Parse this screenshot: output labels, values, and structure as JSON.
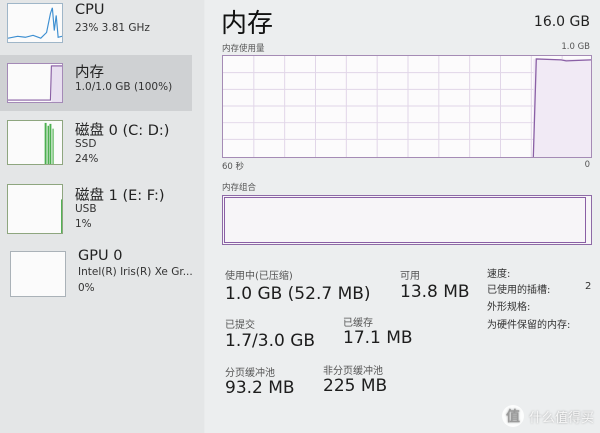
{
  "sidebar": {
    "items": [
      {
        "name": "CPU",
        "line1": "23%  3.81 GHz",
        "line2": ""
      },
      {
        "name": "内存",
        "line1": "1.0/1.0 GB (100%)",
        "line2": ""
      },
      {
        "name": "磁盘 0 (C: D:)",
        "line1": "SSD",
        "line2": "24%"
      },
      {
        "name": "磁盘 1 (E: F:)",
        "line1": "USB",
        "line2": "1%"
      },
      {
        "name": "GPU 0",
        "line1": "Intel(R) Iris(R) Xe Gr...",
        "line2": "0%"
      }
    ]
  },
  "main": {
    "title": "内存",
    "total": "16.0 GB",
    "usage_graph": {
      "label": "内存使用量",
      "max_label": "1.0 GB",
      "time_left": "60 秒",
      "time_right": "0",
      "used_fraction": 1.0
    },
    "composition": {
      "label": "内存组合",
      "used_fraction": 0.98
    },
    "stats": {
      "in_use_label": "使用中(已压缩)",
      "in_use_value": "1.0 GB (52.7 MB)",
      "available_label": "可用",
      "available_value": "13.8 MB",
      "committed_label": "已提交",
      "committed_value": "1.7/3.0 GB",
      "cached_label": "已缓存",
      "cached_value": "17.1 MB",
      "paged_pool_label": "分页缓冲池",
      "paged_pool_value": "93.2 MB",
      "nonpaged_pool_label": "非分页缓冲池",
      "nonpaged_pool_value": "225 MB"
    },
    "right_panel": [
      {
        "label": "速度:",
        "value": ""
      },
      {
        "label": "已使用的插槽:",
        "value": "2"
      },
      {
        "label": "外形规格:",
        "value": ""
      },
      {
        "label": "为硬件保留的内存:",
        "value": ""
      }
    ]
  },
  "watermark": {
    "icon_text": "值",
    "text": "什么值得买"
  },
  "colors": {
    "memory_accent": "#8a5fa5",
    "disk_accent": "#4caf50",
    "cpu_accent": "#3d8fd1"
  }
}
